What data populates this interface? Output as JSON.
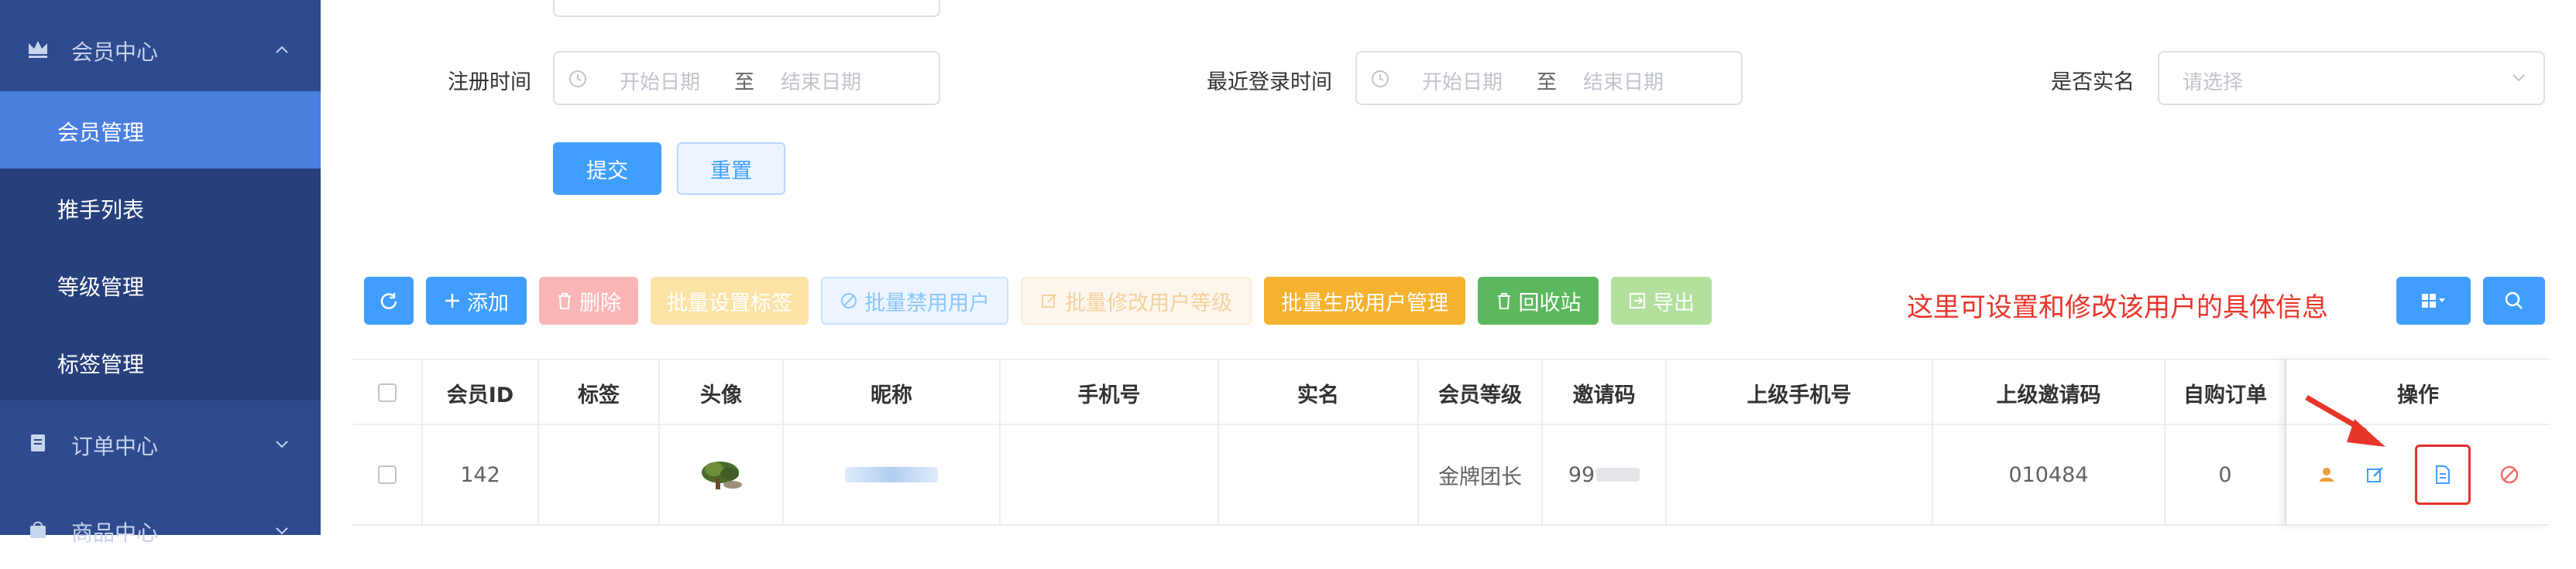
{
  "sidebar": {
    "member_center": "会员中心",
    "order_center": "订单中心",
    "goods_center": "商品中心",
    "items": [
      {
        "label": "会员管理"
      },
      {
        "label": "推手列表"
      },
      {
        "label": "等级管理"
      },
      {
        "label": "标签管理"
      }
    ]
  },
  "filters": {
    "register_time": {
      "label": "注册时间",
      "start": "开始日期",
      "sep": "至",
      "end": "结束日期"
    },
    "last_login": {
      "label": "最近登录时间",
      "start": "开始日期",
      "sep": "至",
      "end": "结束日期"
    },
    "real_name": {
      "label": "是否实名",
      "placeholder": "请选择"
    },
    "submit": "提交",
    "reset": "重置"
  },
  "toolbar": {
    "add": "添加",
    "delete": "删除",
    "batch_tag": "批量设置标签",
    "batch_disable": "批量禁用用户",
    "batch_level": "批量修改用户等级",
    "batch_generate": "批量生成用户管理",
    "recycle": "回收站",
    "export": "导出"
  },
  "annotation": "这里可设置和修改该用户的具体信息",
  "table": {
    "headers": [
      "会员ID",
      "标签",
      "头像",
      "昵称",
      "手机号",
      "实名",
      "会员等级",
      "邀请码",
      "上级手机号",
      "上级邀请码",
      "自购订单",
      "操作"
    ],
    "row": {
      "id": "142",
      "level": "金牌团长",
      "invite_code": "99",
      "parent_invite": "010484",
      "orders": "0"
    }
  },
  "colors": {
    "sidebar": "#2e4b8f",
    "active": "#4a7fe0",
    "primary": "#409eff",
    "danger": "#f56c6c",
    "warning": "#e6a23c",
    "success": "#67c23a",
    "annotation": "#e8352a"
  }
}
